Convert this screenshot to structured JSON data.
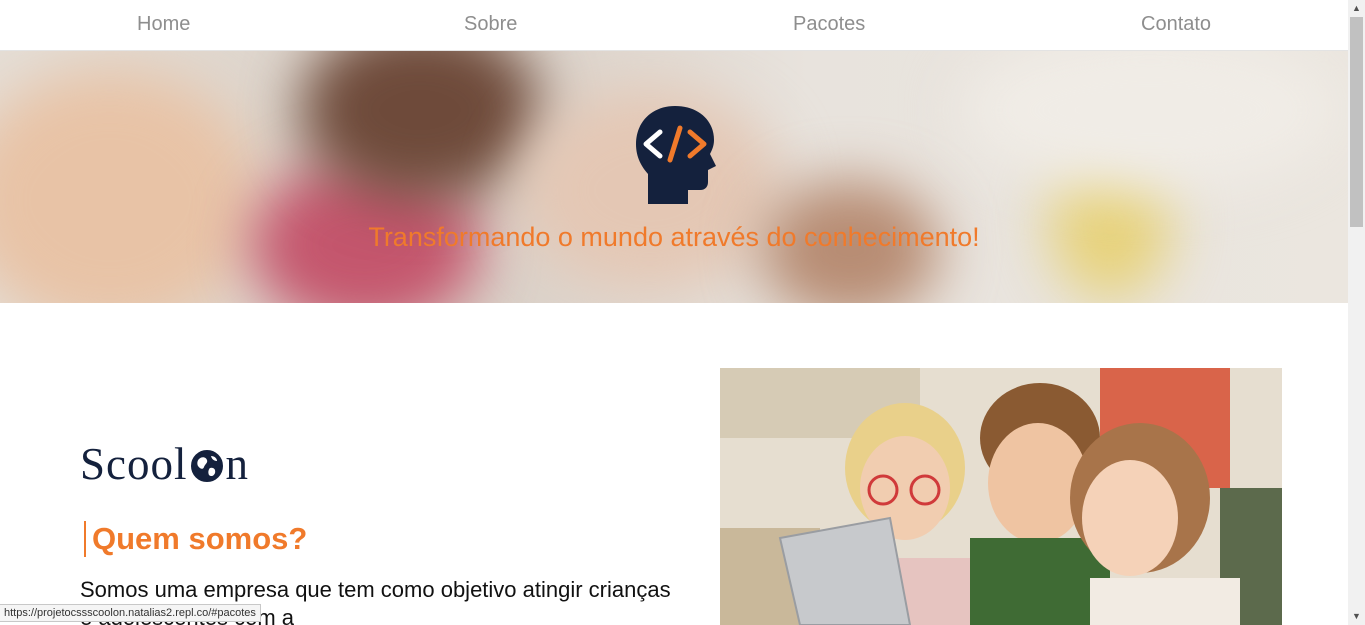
{
  "nav": {
    "items": [
      {
        "label": "Home"
      },
      {
        "label": "Sobre"
      },
      {
        "label": "Pacotes"
      },
      {
        "label": "Contato"
      }
    ]
  },
  "hero": {
    "tagline": "Transformando o mundo através do conhecimento!"
  },
  "about": {
    "brand_prefix": "Scool",
    "brand_suffix": "n",
    "heading": "Quem somos?",
    "paragraph": "Somos uma empresa que tem como objetivo atingir crianças e adolescentes com a"
  },
  "status_bar": {
    "url": "https://projetocssscoolon.natalias2.repl.co/#pacotes"
  },
  "colors": {
    "accent": "#f07a2b",
    "brand_navy": "#14213d",
    "nav_text": "#8e8e8e"
  }
}
